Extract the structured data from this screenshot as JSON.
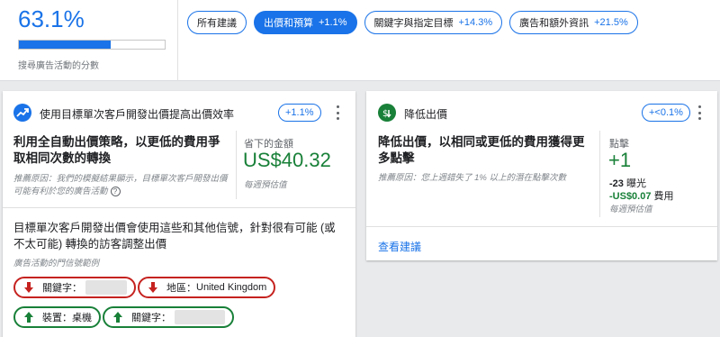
{
  "score": {
    "value": "63.1%",
    "progress": 0.63,
    "label": "搜尋廣告活動的分數"
  },
  "chips": [
    {
      "label": "所有建議",
      "pct": ""
    },
    {
      "label": "出價和預算",
      "pct": "+1.1%"
    },
    {
      "label": "關鍵字與指定目標",
      "pct": "+14.3%"
    },
    {
      "label": "廣告和額外資訊",
      "pct": "+21.5%"
    }
  ],
  "active_chip": 1,
  "left_card": {
    "icon": "trending-up-icon",
    "title": "使用目標單次客戶開發出價提高出價效率",
    "badge": "+1.1%",
    "headline": "利用全自動出價策略，以更低的費用爭取相同次數的轉換",
    "savings_label": "省下的金額",
    "savings_value": "US$40.32",
    "weekly_estimate": "每週預估值",
    "reason": "推薦原因：我們的模擬結果顯示，目標單次客戶開發出價可能有利於您的廣告活動",
    "body": "目標單次客戶開發出價會使用這些和其他信號，針對很有可能 (或不太可能) 轉換的訪客調整出價",
    "signals_label": "廣告活動的門信號範例",
    "signals": [
      {
        "direction": "down",
        "label": "關鍵字：",
        "value": ""
      },
      {
        "direction": "down",
        "label": "地區：",
        "value": "United Kingdom"
      },
      {
        "direction": "up",
        "label": "裝置：",
        "value": "桌機"
      },
      {
        "direction": "up",
        "label": "關鍵字：",
        "value": ""
      }
    ]
  },
  "right_card": {
    "icon": "lower-bid-icon",
    "title": "降低出價",
    "badge": "+<0.1%",
    "headline": "降低出價，以相同或更低的費用獲得更多點擊",
    "clicks_label": "點擊",
    "clicks_value": "+1",
    "impressions_value": "-23",
    "impressions_label": "曝光",
    "cost_value": "-US$0.07",
    "cost_label": "費用",
    "weekly_estimate": "每週預估值",
    "reason": "推薦原因：您上週錯失了 1% 以上的潛在點擊次數",
    "view_link": "查看建議"
  },
  "colors": {
    "accent": "#1a73e8",
    "positive": "#188038",
    "negative": "#c5221f"
  }
}
